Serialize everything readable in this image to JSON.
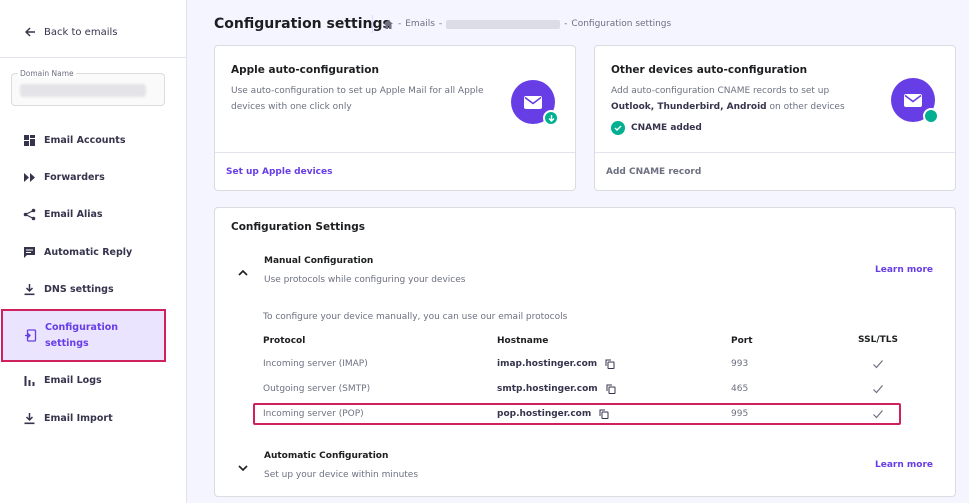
{
  "sidebar": {
    "back_label": "Back to emails",
    "domain_label": "Domain Name",
    "items": [
      {
        "label": "Email Accounts",
        "icon": "grid-icon"
      },
      {
        "label": "Forwarders",
        "icon": "forward-icon"
      },
      {
        "label": "Email Alias",
        "icon": "share-icon"
      },
      {
        "label": "Automatic Reply",
        "icon": "reply-icon"
      },
      {
        "label": "DNS settings",
        "icon": "download-icon"
      },
      {
        "label": "Configuration settings",
        "icon": "config-icon"
      },
      {
        "label": "Email Logs",
        "icon": "bar-chart-icon"
      },
      {
        "label": "Email Import",
        "icon": "import-icon"
      }
    ]
  },
  "header": {
    "title": "Configuration settings",
    "breadcrumb": [
      "Emails",
      "Configuration settings"
    ]
  },
  "apple_card": {
    "title": "Apple auto-configuration",
    "description": "Use auto-configuration to set up Apple Mail for all Apple devices with one click only",
    "action": "Set up Apple devices"
  },
  "other_card": {
    "title": "Other devices auto-configuration",
    "desc_pre": "Add auto-configuration CNAME records to set up",
    "desc_bold": "Outlook, Thunderbird, Android",
    "desc_post": "on other devices",
    "status": "CNAME added",
    "action": "Add CNAME record"
  },
  "config": {
    "title": "Configuration Settings",
    "manual": {
      "title": "Manual Configuration",
      "subtitle": "Use protocols while configuring your devices",
      "learn_more": "Learn more",
      "intro": "To configure your device manually, you can use our email protocols",
      "columns": [
        "Protocol",
        "Hostname",
        "Port",
        "SSL/TLS"
      ],
      "rows": [
        {
          "protocol": "Incoming server (IMAP)",
          "hostname": "imap.hostinger.com",
          "port": "993"
        },
        {
          "protocol": "Outgoing server (SMTP)",
          "hostname": "smtp.hostinger.com",
          "port": "465"
        },
        {
          "protocol": "Incoming server (POP)",
          "hostname": "pop.hostinger.com",
          "port": "995"
        }
      ]
    },
    "automatic": {
      "title": "Automatic Configuration",
      "subtitle": "Set up your device within minutes",
      "learn_more": "Learn more"
    }
  },
  "colors": {
    "accent": "#673de6",
    "success": "#00b090",
    "highlight": "#d1205e"
  }
}
